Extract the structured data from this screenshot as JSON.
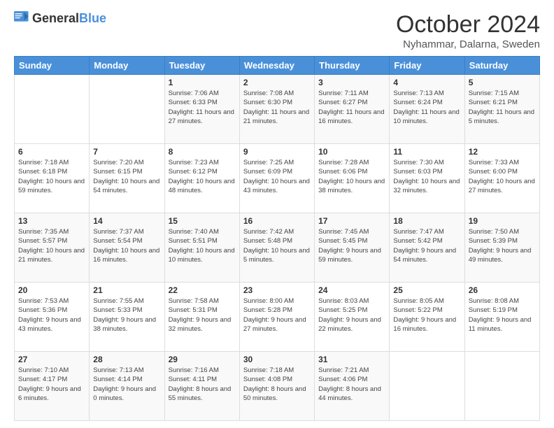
{
  "logo": {
    "general": "General",
    "blue": "Blue"
  },
  "header": {
    "month": "October 2024",
    "location": "Nyhammar, Dalarna, Sweden"
  },
  "days_of_week": [
    "Sunday",
    "Monday",
    "Tuesday",
    "Wednesday",
    "Thursday",
    "Friday",
    "Saturday"
  ],
  "weeks": [
    [
      {
        "day": "",
        "info": ""
      },
      {
        "day": "",
        "info": ""
      },
      {
        "day": "1",
        "info": "Sunrise: 7:06 AM\nSunset: 6:33 PM\nDaylight: 11 hours and 27 minutes."
      },
      {
        "day": "2",
        "info": "Sunrise: 7:08 AM\nSunset: 6:30 PM\nDaylight: 11 hours and 21 minutes."
      },
      {
        "day": "3",
        "info": "Sunrise: 7:11 AM\nSunset: 6:27 PM\nDaylight: 11 hours and 16 minutes."
      },
      {
        "day": "4",
        "info": "Sunrise: 7:13 AM\nSunset: 6:24 PM\nDaylight: 11 hours and 10 minutes."
      },
      {
        "day": "5",
        "info": "Sunrise: 7:15 AM\nSunset: 6:21 PM\nDaylight: 11 hours and 5 minutes."
      }
    ],
    [
      {
        "day": "6",
        "info": "Sunrise: 7:18 AM\nSunset: 6:18 PM\nDaylight: 10 hours and 59 minutes."
      },
      {
        "day": "7",
        "info": "Sunrise: 7:20 AM\nSunset: 6:15 PM\nDaylight: 10 hours and 54 minutes."
      },
      {
        "day": "8",
        "info": "Sunrise: 7:23 AM\nSunset: 6:12 PM\nDaylight: 10 hours and 48 minutes."
      },
      {
        "day": "9",
        "info": "Sunrise: 7:25 AM\nSunset: 6:09 PM\nDaylight: 10 hours and 43 minutes."
      },
      {
        "day": "10",
        "info": "Sunrise: 7:28 AM\nSunset: 6:06 PM\nDaylight: 10 hours and 38 minutes."
      },
      {
        "day": "11",
        "info": "Sunrise: 7:30 AM\nSunset: 6:03 PM\nDaylight: 10 hours and 32 minutes."
      },
      {
        "day": "12",
        "info": "Sunrise: 7:33 AM\nSunset: 6:00 PM\nDaylight: 10 hours and 27 minutes."
      }
    ],
    [
      {
        "day": "13",
        "info": "Sunrise: 7:35 AM\nSunset: 5:57 PM\nDaylight: 10 hours and 21 minutes."
      },
      {
        "day": "14",
        "info": "Sunrise: 7:37 AM\nSunset: 5:54 PM\nDaylight: 10 hours and 16 minutes."
      },
      {
        "day": "15",
        "info": "Sunrise: 7:40 AM\nSunset: 5:51 PM\nDaylight: 10 hours and 10 minutes."
      },
      {
        "day": "16",
        "info": "Sunrise: 7:42 AM\nSunset: 5:48 PM\nDaylight: 10 hours and 5 minutes."
      },
      {
        "day": "17",
        "info": "Sunrise: 7:45 AM\nSunset: 5:45 PM\nDaylight: 9 hours and 59 minutes."
      },
      {
        "day": "18",
        "info": "Sunrise: 7:47 AM\nSunset: 5:42 PM\nDaylight: 9 hours and 54 minutes."
      },
      {
        "day": "19",
        "info": "Sunrise: 7:50 AM\nSunset: 5:39 PM\nDaylight: 9 hours and 49 minutes."
      }
    ],
    [
      {
        "day": "20",
        "info": "Sunrise: 7:53 AM\nSunset: 5:36 PM\nDaylight: 9 hours and 43 minutes."
      },
      {
        "day": "21",
        "info": "Sunrise: 7:55 AM\nSunset: 5:33 PM\nDaylight: 9 hours and 38 minutes."
      },
      {
        "day": "22",
        "info": "Sunrise: 7:58 AM\nSunset: 5:31 PM\nDaylight: 9 hours and 32 minutes."
      },
      {
        "day": "23",
        "info": "Sunrise: 8:00 AM\nSunset: 5:28 PM\nDaylight: 9 hours and 27 minutes."
      },
      {
        "day": "24",
        "info": "Sunrise: 8:03 AM\nSunset: 5:25 PM\nDaylight: 9 hours and 22 minutes."
      },
      {
        "day": "25",
        "info": "Sunrise: 8:05 AM\nSunset: 5:22 PM\nDaylight: 9 hours and 16 minutes."
      },
      {
        "day": "26",
        "info": "Sunrise: 8:08 AM\nSunset: 5:19 PM\nDaylight: 9 hours and 11 minutes."
      }
    ],
    [
      {
        "day": "27",
        "info": "Sunrise: 7:10 AM\nSunset: 4:17 PM\nDaylight: 9 hours and 6 minutes."
      },
      {
        "day": "28",
        "info": "Sunrise: 7:13 AM\nSunset: 4:14 PM\nDaylight: 9 hours and 0 minutes."
      },
      {
        "day": "29",
        "info": "Sunrise: 7:16 AM\nSunset: 4:11 PM\nDaylight: 8 hours and 55 minutes."
      },
      {
        "day": "30",
        "info": "Sunrise: 7:18 AM\nSunset: 4:08 PM\nDaylight: 8 hours and 50 minutes."
      },
      {
        "day": "31",
        "info": "Sunrise: 7:21 AM\nSunset: 4:06 PM\nDaylight: 8 hours and 44 minutes."
      },
      {
        "day": "",
        "info": ""
      },
      {
        "day": "",
        "info": ""
      }
    ]
  ]
}
